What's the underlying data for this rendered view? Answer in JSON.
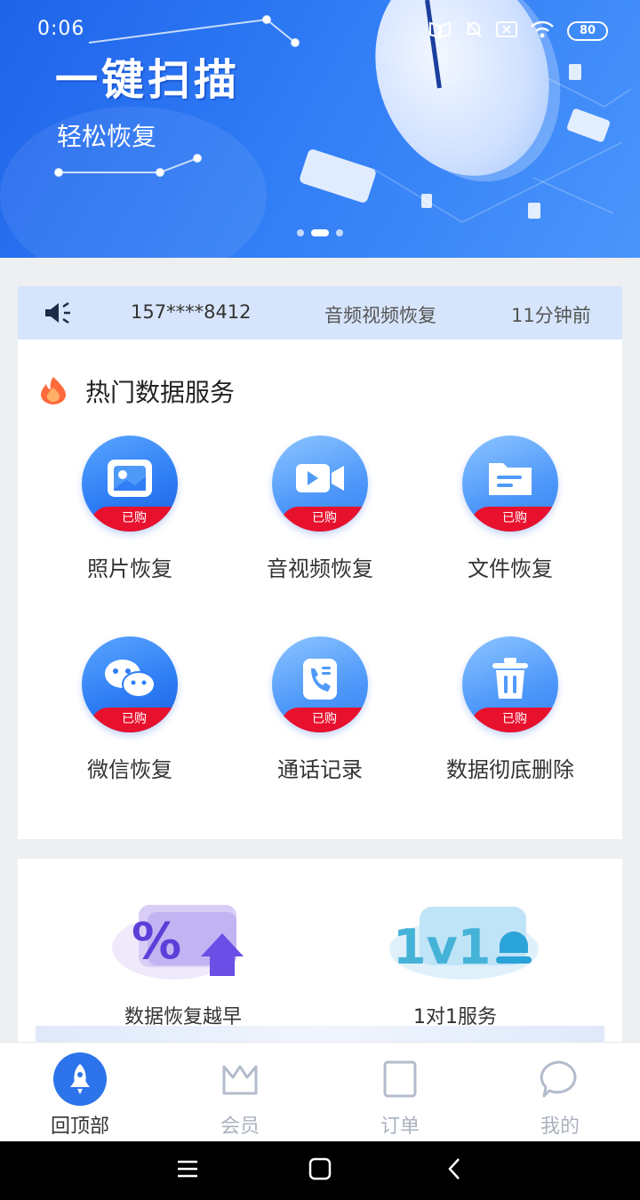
{
  "status_bar": {
    "time": "0:06",
    "battery": "80",
    "icons": [
      "book-icon",
      "silent-bell-icon",
      "sim-x-icon",
      "wifi-icon",
      "battery-icon"
    ]
  },
  "banner": {
    "title": "一键扫描",
    "subtitle": "轻松恢复",
    "carousel_count": 3,
    "carousel_active": 1
  },
  "notice": {
    "phone": "157****8412",
    "service": "音频视频恢复",
    "time_ago": "11分钟前"
  },
  "hot_services": {
    "title": "热门数据服务",
    "badge": "已购",
    "items": [
      {
        "label": "照片恢复",
        "icon": "photo-icon"
      },
      {
        "label": "音视频恢复",
        "icon": "video-camera-icon"
      },
      {
        "label": "文件恢复",
        "icon": "folder-icon"
      },
      {
        "label": "微信恢复",
        "icon": "wechat-icon"
      },
      {
        "label": "通话记录",
        "icon": "phone-record-icon"
      },
      {
        "label": "数据彻底删除",
        "icon": "trash-icon"
      }
    ]
  },
  "promos": [
    {
      "label": "数据恢复越早",
      "icon": "percent-up-icon"
    },
    {
      "label": "1对1服务",
      "icon": "one-v-one-icon"
    }
  ],
  "promo_art": {
    "percent": "%",
    "one_v_one": "1v1"
  },
  "bottom_nav": [
    {
      "label": "回顶部",
      "icon": "rocket-icon",
      "active": true
    },
    {
      "label": "会员",
      "icon": "crown-icon",
      "active": false
    },
    {
      "label": "订单",
      "icon": "order-icon",
      "active": false
    },
    {
      "label": "我的",
      "icon": "chat-bubble-icon",
      "active": false
    }
  ],
  "colors": {
    "primary": "#2c73ec",
    "badge_red": "#e8112d",
    "notice_bg": "#d6e5fb",
    "page_bg": "#eeeff1"
  }
}
